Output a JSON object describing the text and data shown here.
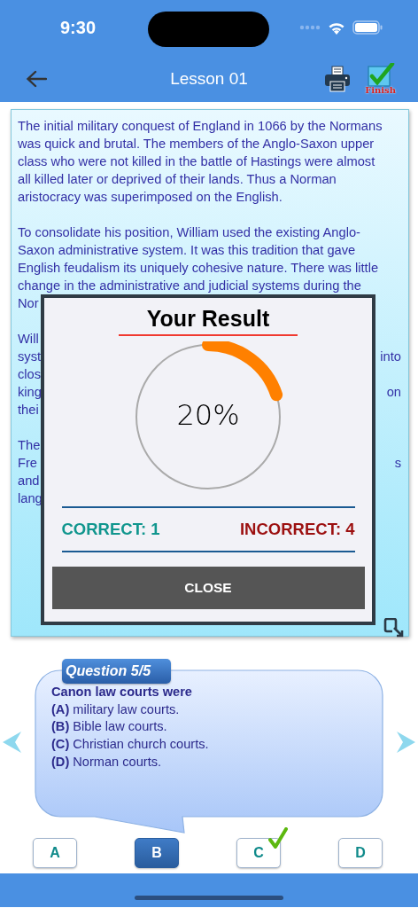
{
  "status_bar": {
    "time": "9:30"
  },
  "nav": {
    "title": "Lesson 01",
    "finish_label": "Finish"
  },
  "passage": {
    "paragraphs": [
      {
        "lines": [
          {
            "left": "The initial military conquest of England in 1066 by the Normans"
          },
          {
            "left": "was quick and brutal. The members of the Anglo-Saxon upper"
          },
          {
            "left": "class who were not killed in the battle of Hastings were almost"
          },
          {
            "left": "all killed later or deprived of their lands. Thus a Norman"
          },
          {
            "left": "aristocracy was superimposed on the English."
          }
        ]
      },
      {
        "lines": [
          {
            "left": "To consolidate his position, William used the existing Anglo-"
          },
          {
            "left": "Saxon administrative system. It was this tradition that gave"
          },
          {
            "left": "English feudalism its uniquely cohesive nature. There was little"
          },
          {
            "left": "change in the administrative and judicial systems during the"
          },
          {
            "left": "Nor"
          }
        ]
      },
      {
        "lines": [
          {
            "left": "Will"
          },
          {
            "left": "syst",
            "right": "into"
          },
          {
            "left": "clos"
          },
          {
            "left": "king",
            "right": "on"
          },
          {
            "left": "thei"
          }
        ]
      },
      {
        "lines": [
          {
            "left": "The"
          },
          {
            "left": "Fre",
            "right": "s"
          },
          {
            "left": "and"
          },
          {
            "left": "lang"
          }
        ]
      }
    ]
  },
  "result": {
    "title": "Your Result",
    "level": 0.2,
    "percent": "20%",
    "correct": "CORRECT: 1",
    "incorrect": "INCORRECT: 4",
    "close": "CLOSE"
  },
  "question": {
    "tab": "Question 5/5",
    "text": "Canon law courts were",
    "options": [
      "**(A)** military law courts.",
      "**(B)** Bible law courts.",
      "**(C)** Christian church courts.",
      "**(D)** Norman courts."
    ]
  },
  "answers": [
    {
      "label": "A",
      "selected": false,
      "correct": false
    },
    {
      "label": "B",
      "selected": true,
      "correct": false
    },
    {
      "label": "C",
      "selected": false,
      "correct": true
    },
    {
      "label": "D",
      "selected": false,
      "correct": false
    }
  ]
}
